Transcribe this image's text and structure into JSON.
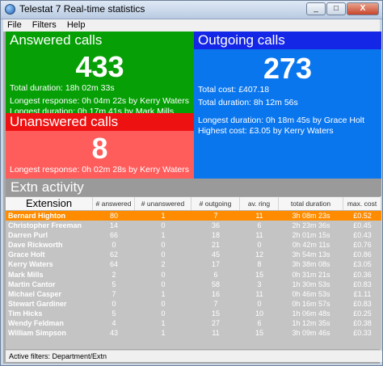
{
  "window": {
    "title": "Telestat 7 Real-time statistics",
    "min": "_",
    "max": "□",
    "close": "X"
  },
  "menu": [
    "File",
    "Filters",
    "Help"
  ],
  "answered": {
    "title": "Answered calls",
    "count": "433",
    "total_duration": "Total duration: 18h 02m 33s",
    "longest_response": "Longest response: 0h 04m 22s by Kerry Waters",
    "longest_duration": "Longest duration: 0h 17m 41s by Mark Mills"
  },
  "unanswered": {
    "title": "Unanswered calls",
    "count": "8",
    "longest_response": "Longest response: 0h 02m 28s by Kerry Waters"
  },
  "outgoing": {
    "title": "Outgoing calls",
    "count": "273",
    "total_cost": "Total cost: £407.18",
    "total_duration": "Total duration: 8h 12m 56s",
    "longest_duration": "Longest duration: 0h 18m 45s by Grace Holt",
    "highest_cost": "Highest cost: £3.05 by Kerry Waters"
  },
  "extn": {
    "title": "Extn activity",
    "columns": [
      "Extension",
      "# answered",
      "# unanswered",
      "# outgoing",
      "av. ring",
      "total duration",
      "max. cost"
    ],
    "rows": [
      [
        "Bernard Highton",
        "80",
        "1",
        "7",
        "11",
        "3h 08m 23s",
        "£0.52"
      ],
      [
        "Christopher Freeman",
        "14",
        "0",
        "36",
        "6",
        "2h 23m 36s",
        "£0.45"
      ],
      [
        "Darren Purl",
        "66",
        "1",
        "18",
        "11",
        "2h 01m 15s",
        "£0.43"
      ],
      [
        "Dave Rickworth",
        "0",
        "0",
        "21",
        "0",
        "0h 42m 11s",
        "£0.76"
      ],
      [
        "Grace Holt",
        "62",
        "0",
        "45",
        "12",
        "3h 54m 13s",
        "£0.86"
      ],
      [
        "Kerry Waters",
        "64",
        "2",
        "17",
        "8",
        "3h 38m 08s",
        "£3.05"
      ],
      [
        "Mark Mills",
        "2",
        "0",
        "6",
        "15",
        "0h 31m 21s",
        "£0.36"
      ],
      [
        "Martin Cantor",
        "5",
        "0",
        "58",
        "3",
        "1h 30m 53s",
        "£0.83"
      ],
      [
        "Michael Casper",
        "7",
        "1",
        "16",
        "11",
        "0h 46m 53s",
        "£1.11"
      ],
      [
        "Stewart Gardiner",
        "0",
        "0",
        "7",
        "0",
        "0h 16m 57s",
        "£0.83"
      ],
      [
        "Tim Hicks",
        "5",
        "0",
        "15",
        "10",
        "1h 06m 48s",
        "£0.25"
      ],
      [
        "Wendy Feldman",
        "4",
        "1",
        "27",
        "6",
        "1h 12m 35s",
        "£0.38"
      ],
      [
        "William Simpson",
        "43",
        "1",
        "11",
        "15",
        "3h 09m 46s",
        "£0.33"
      ]
    ]
  },
  "status": {
    "text": "Active filters: Department/Extn"
  },
  "colors": {
    "answered": "#06a006",
    "unanswered_head": "#ee1111",
    "unanswered_body": "#ff5c5c",
    "outgoing_head": "#1426e6",
    "outgoing_body": "#0a76ee",
    "selected_row": "#ff8c00"
  }
}
